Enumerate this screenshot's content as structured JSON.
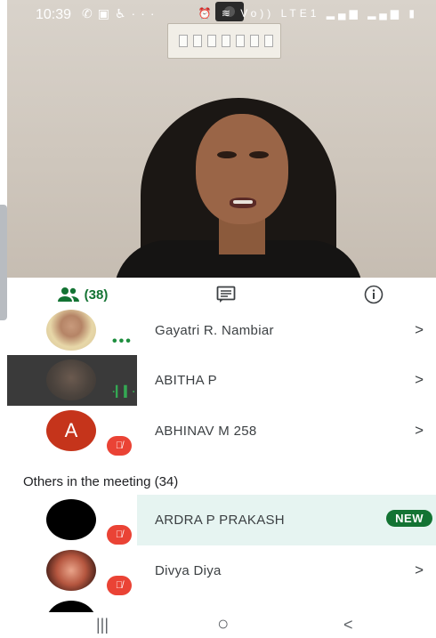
{
  "status_bar": {
    "time": "10:39",
    "left_icons": [
      "whatsapp-icon",
      "gallery-icon",
      "accessibility-icon",
      "more-dots-icon"
    ],
    "right_icons": [
      "alarm-icon",
      "wifi-icon",
      "lte-icon",
      "signal-icon",
      "signal-icon",
      "battery-icon"
    ],
    "lte_label": "Vo)) LTE1"
  },
  "tabs": {
    "people_count": "(38)",
    "chat_icon": "chat-icon",
    "info_icon": "info-icon",
    "active_color": "#137333"
  },
  "participants": [
    {
      "name": "Gayatri R. Nambiar",
      "indicator": "speaking-dots",
      "chevron": ">"
    },
    {
      "name": "ABITHA P",
      "indicator": "audio-wave",
      "chevron": ">"
    },
    {
      "name": "ABHINAV M 258",
      "avatar_letter": "A",
      "indicator": "muted",
      "chevron": ">"
    }
  ],
  "others_section": {
    "title": "Others in the meeting (34)",
    "items": [
      {
        "name": "ARDRA P PRAKASH",
        "badge": "NEW",
        "highlighted": true,
        "indicator": "muted"
      },
      {
        "name": "Divya Diya",
        "indicator": "muted",
        "chevron": ">"
      }
    ]
  },
  "nav_bar": {
    "recents": "|||",
    "home": "○",
    "back": "<"
  },
  "colors": {
    "muted": "#ea4335",
    "highlight_row": "#e6f4f1",
    "badge": "#137333",
    "avatar_letter_bg": "#c5341b"
  }
}
